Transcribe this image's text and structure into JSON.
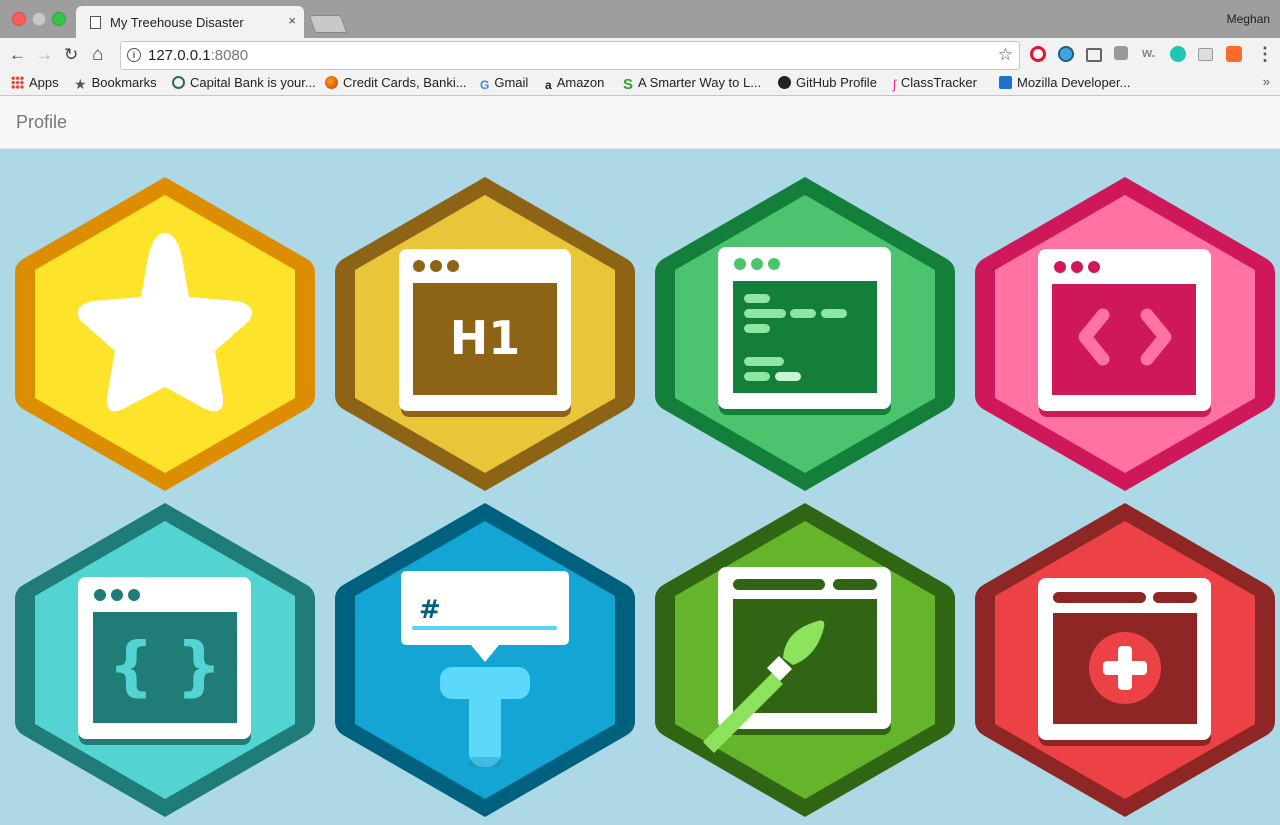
{
  "browser": {
    "tab_title": "My Treehouse Disaster",
    "close_glyph": "×",
    "user_name": "Meghan",
    "url_host": "127.0.0.1",
    "url_port": ":8080",
    "back_glyph": "←",
    "forward_glyph": "→",
    "reload_glyph": "↻",
    "home_glyph": "⌂",
    "star_glyph": "☆",
    "menu_glyph": "⋮",
    "overflow_glyph": "»"
  },
  "bookmarks": [
    {
      "label": "Apps",
      "icon": "apps-grid-icon"
    },
    {
      "label": "Bookmarks",
      "icon": "star-icon"
    },
    {
      "label": "Capital Bank is your...",
      "icon": "eye-icon"
    },
    {
      "label": "Credit Cards, Banki...",
      "icon": "circle-icon"
    },
    {
      "label": "Gmail",
      "icon": "google-icon"
    },
    {
      "label": "Amazon",
      "icon": "amazon-icon"
    },
    {
      "label": "A Smarter Way to L...",
      "icon": "s-logo-icon"
    },
    {
      "label": "GitHub Profile",
      "icon": "github-icon"
    },
    {
      "label": "ClassTracker",
      "icon": "flamingo-icon"
    },
    {
      "label": "Mozilla Developer...",
      "icon": "mdn-icon"
    }
  ],
  "navbar": {
    "brand": "Profile"
  },
  "badges": [
    {
      "name": "star-badge",
      "kind": "star",
      "outer": "#dc8e00",
      "inner": "#fde32a"
    },
    {
      "name": "html-h1-badge",
      "kind": "h1",
      "screen_text": "H1",
      "outer": "#8d6316",
      "inner": "#e9c53a",
      "screen": "#8d6316"
    },
    {
      "name": "code-lines-badge",
      "kind": "code",
      "outer": "#137f3a",
      "inner": "#4cc46d",
      "screen": "#137f3a"
    },
    {
      "name": "angle-brackets-badge",
      "kind": "brackets",
      "screen_text": "<>",
      "outer": "#cf1859",
      "inner": "#ff72a2",
      "screen": "#cf1859"
    },
    {
      "name": "curly-braces-badge",
      "kind": "curly",
      "screen_text": "{ }",
      "outer": "#1f7c76",
      "inner": "#53d4d2",
      "screen": "#1f7c76"
    },
    {
      "name": "hashtag-typography-badge",
      "kind": "type",
      "screen_text": "#",
      "outer": "#00617f",
      "inner": "#13a5d3"
    },
    {
      "name": "paintbrush-badge",
      "kind": "paint",
      "outer": "#306613",
      "inner": "#64b52c",
      "screen": "#306613"
    },
    {
      "name": "plus-badge",
      "kind": "plus",
      "outer": "#8e2626",
      "inner": "#ec4245",
      "screen": "#8e2626"
    }
  ]
}
